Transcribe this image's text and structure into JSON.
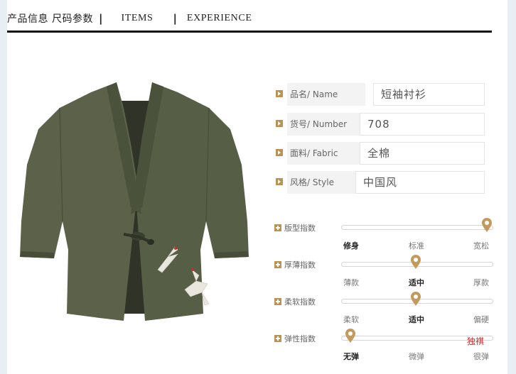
{
  "header": {
    "title_cn": "产品信息 尺码参数",
    "sep": "|",
    "items": "ITEMS",
    "experience": "EXPERIENCE"
  },
  "product_image": {
    "subject": "olive-green kimono jacket with crane embroidery"
  },
  "info": [
    {
      "label": "品名/ Name",
      "value": "短袖衬衫"
    },
    {
      "label": "货号/ Number",
      "value": "708"
    },
    {
      "label": "面料/ Fabric",
      "value": "全棉"
    },
    {
      "label": "风格/ Style",
      "value": "中国风"
    }
  ],
  "indices": [
    {
      "title": "版型指数",
      "options": [
        "修身",
        "标准",
        "宽松"
      ],
      "selected_index": 0,
      "marker_position": 0.96
    },
    {
      "title": "厚薄指数",
      "options": [
        "薄款",
        "适中",
        "厚款"
      ],
      "selected_index": 1,
      "marker_position": 0.49
    },
    {
      "title": "柔软指数",
      "options": [
        "柔软",
        "适中",
        "偏硬"
      ],
      "selected_index": 1,
      "marker_position": 0.49
    },
    {
      "title": "弹性指数",
      "options": [
        "无弹",
        "微弹",
        "很弹"
      ],
      "selected_index": 0,
      "marker_position": 0.06
    }
  ],
  "watermark": "独祺",
  "colors": {
    "accent": "#b99256",
    "header_line": "#111111",
    "watermark": "#d42020",
    "jacket": "#545c45"
  }
}
